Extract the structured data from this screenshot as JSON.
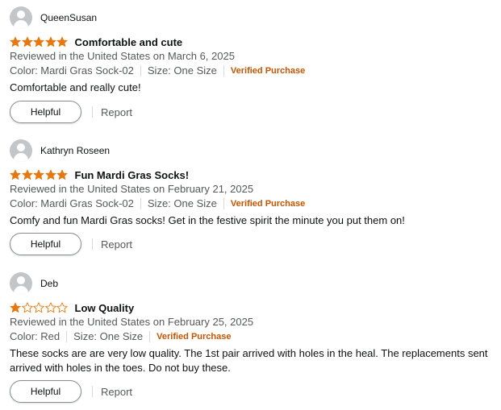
{
  "colors": {
    "star": "#e47911",
    "star_empty": "#e47911",
    "verified": "#c45500",
    "muted": "#565959",
    "text": "#0f1111"
  },
  "icons": {
    "avatar": "user-silhouette-icon",
    "star_full": "star-filled-icon",
    "star_empty": "star-outline-icon"
  },
  "reviews": [
    {
      "name": "QueenSusan",
      "rating": 5,
      "title": "Comfortable and cute",
      "date": "Reviewed in the United States on March 6, 2025",
      "color": "Color: Mardi Gras Sock-02",
      "size": "Size: One Size",
      "verified": "Verified Purchase",
      "body": "Comfortable and really cute!",
      "helpful": "Helpful",
      "report": "Report"
    },
    {
      "name": "Kathryn Roseen",
      "rating": 5,
      "title": "Fun Mardi Gras Socks!",
      "date": "Reviewed in the United States on February 21, 2025",
      "color": "Color: Mardi Gras Sock-02",
      "size": "Size: One Size",
      "verified": "Verified Purchase",
      "body": "Comfy and fun Mardi Gras socks! Get in the festive spirit the minute you put them on!",
      "helpful": "Helpful",
      "report": "Report"
    },
    {
      "name": "Deb",
      "rating": 1,
      "title": "Low Quality",
      "date": "Reviewed in the United States on February 25, 2025",
      "color": "Color: Red",
      "size": "Size: One Size",
      "verified": "Verified Purchase",
      "body": "These socks are are very low quality. The 1st pair arrived with holes in the heal. The replacements sent arrived with holes in the toes. Do not buy these.",
      "helpful": "Helpful",
      "report": "Report"
    }
  ]
}
